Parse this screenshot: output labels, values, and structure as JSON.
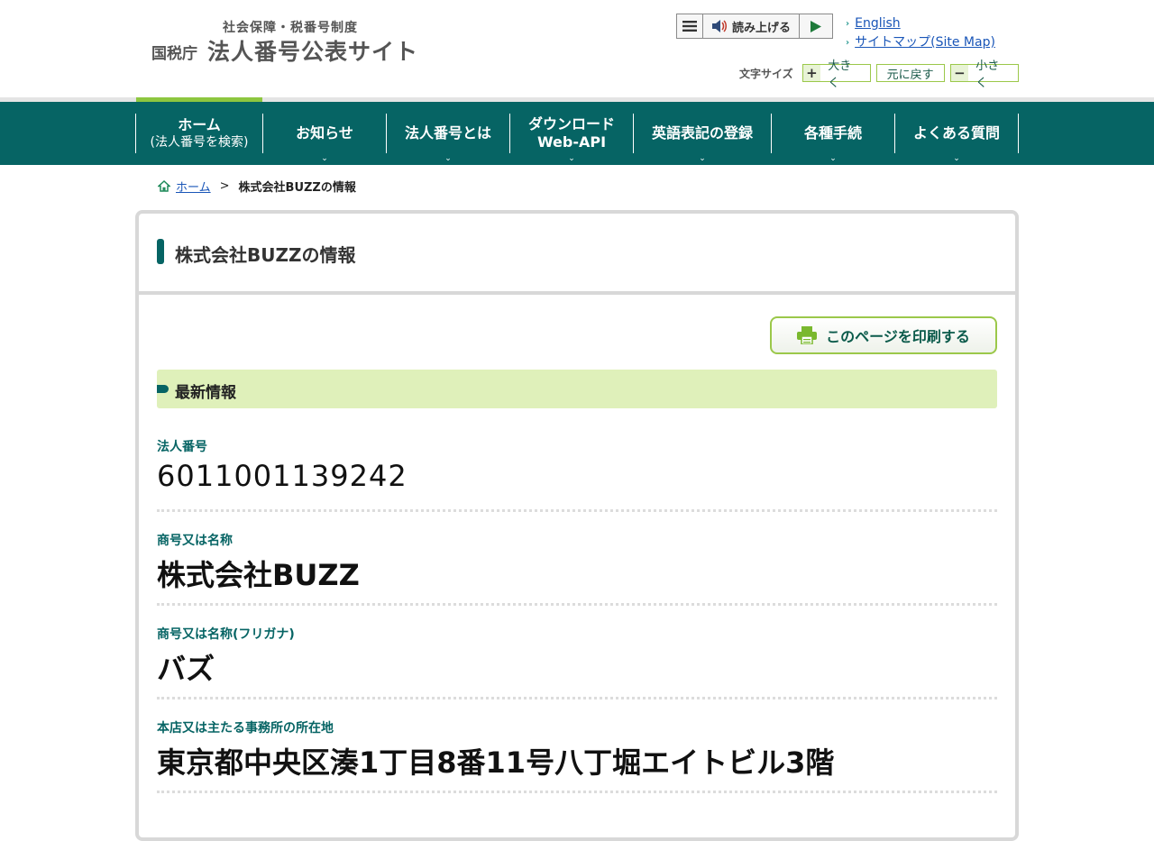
{
  "header": {
    "logo_subtitle": "社会保障・税番号制度",
    "logo_agency": "国税庁",
    "logo_name": "法人番号公表サイト",
    "read_aloud_label": "読み上げる",
    "links": [
      {
        "label": "English"
      },
      {
        "label": "サイトマップ(Site Map)"
      }
    ],
    "font_size": {
      "label": "文字サイズ",
      "larger": "大きく",
      "reset": "元に戻す",
      "smaller": "小さく"
    }
  },
  "nav": {
    "items": [
      {
        "line1": "ホーム",
        "line2": "(法人番号を検索)",
        "has_menu": false
      },
      {
        "line1": "お知らせ",
        "line2": "",
        "has_menu": true
      },
      {
        "line1": "法人番号とは",
        "line2": "",
        "has_menu": true
      },
      {
        "line1": "ダウンロード",
        "line2": "Web-API",
        "has_menu": true
      },
      {
        "line1": "英語表記の登録",
        "line2": "",
        "has_menu": true
      },
      {
        "line1": "各種手続",
        "line2": "",
        "has_menu": true
      },
      {
        "line1": "よくある質問",
        "line2": "",
        "has_menu": true
      }
    ]
  },
  "breadcrumb": {
    "home": "ホーム",
    "separator": ">",
    "current": "株式会社BUZZの情報"
  },
  "main": {
    "title": "株式会社BUZZの情報",
    "print_label": "このページを印刷する",
    "section_title": "最新情報",
    "fields": [
      {
        "label": "法人番号",
        "value": "6011001139242"
      },
      {
        "label": "商号又は名称",
        "value": "株式会社BUZZ"
      },
      {
        "label": "商号又は名称(フリガナ)",
        "value": "バズ"
      },
      {
        "label": "本店又は主たる事務所の所在地",
        "value": "東京都中央区湊1丁目8番11号八丁堀エイトビル3階"
      }
    ]
  },
  "colors": {
    "brand_green": "#066464",
    "accent_lime": "#8dc63f",
    "section_bg": "#dff0ba",
    "link_blue": "#1a56b8"
  }
}
